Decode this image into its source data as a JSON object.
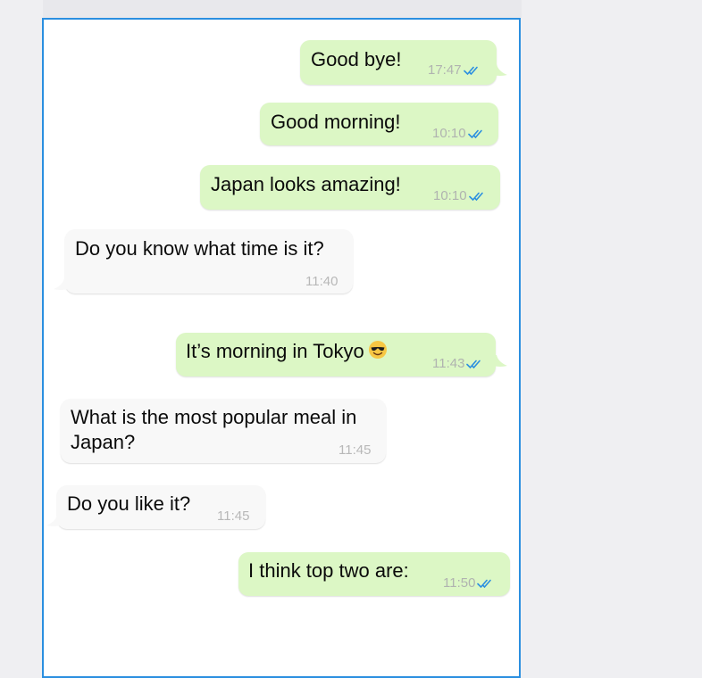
{
  "colors": {
    "outgoing_bubble": "#dcf7c5",
    "incoming_bubble": "#f8f8f8",
    "read_ticks": "#2b8fe0",
    "pane_border": "#2b8fe0"
  },
  "messages": [
    {
      "direction": "out",
      "text": "Good bye!",
      "time": "17:47",
      "status": "read-double-tick-icon"
    },
    {
      "direction": "out",
      "text": "Good morning!",
      "time": "10:10",
      "status": "read-double-tick-icon"
    },
    {
      "direction": "out",
      "text": "Japan looks amazing!",
      "time": "10:10",
      "status": "read-double-tick-icon"
    },
    {
      "direction": "in",
      "text": "Do you know what time is it?",
      "time": "11:40"
    },
    {
      "direction": "out",
      "text": "It’s morning in Tokyo",
      "emoji": "smiling-face-with-sunglasses-emoji",
      "time": "11:43",
      "status": "read-double-tick-icon"
    },
    {
      "direction": "in",
      "text_line1": "What is the most popular meal in",
      "text_line2": "Japan?",
      "time": "11:45"
    },
    {
      "direction": "in",
      "text": "Do you like it?",
      "time": "11:45"
    },
    {
      "direction": "out",
      "text": "I think top two are:",
      "time": "11:50",
      "status": "read-double-tick-icon"
    }
  ]
}
